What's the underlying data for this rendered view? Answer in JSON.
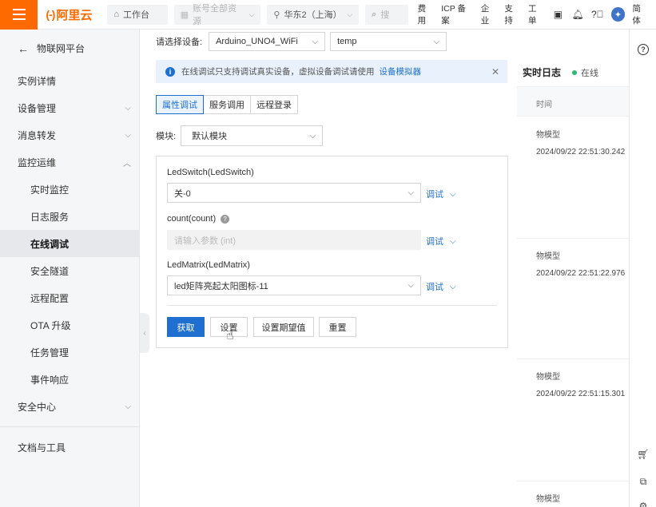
{
  "topbar": {
    "brand": "阿里云",
    "brand_mark": "(-)",
    "workbench": "工作台",
    "account_scope": "账号全部资源",
    "region": "华东2（上海）",
    "search_placeholder": "搜",
    "links": [
      "费用",
      "ICP 备案",
      "企业",
      "支持",
      "工单"
    ],
    "lang": "简体"
  },
  "sidebar": {
    "back_label": "物联网平台",
    "items": [
      {
        "label": "实例详情",
        "expandable": false
      },
      {
        "label": "设备管理",
        "expandable": true,
        "expanded": false
      },
      {
        "label": "消息转发",
        "expandable": true,
        "expanded": false
      },
      {
        "label": "监控运维",
        "expandable": true,
        "expanded": true
      },
      {
        "label": "实时监控",
        "sub": true
      },
      {
        "label": "日志服务",
        "sub": true
      },
      {
        "label": "在线调试",
        "sub": true,
        "active": true
      },
      {
        "label": "安全隧道",
        "sub": true
      },
      {
        "label": "远程配置",
        "sub": true
      },
      {
        "label": "OTA 升级",
        "sub": true
      },
      {
        "label": "任务管理",
        "sub": true
      },
      {
        "label": "事件响应",
        "sub": true
      },
      {
        "label": "安全中心",
        "expandable": true,
        "expanded": false
      }
    ],
    "footer_item": "文档与工具"
  },
  "device": {
    "label": "请选择设备:",
    "product": "Arduino_UNO4_WiFi",
    "device_name": "temp"
  },
  "info": {
    "text": "在线调试只支持调试真实设备，虚拟设备调试请使用",
    "link": "设备模拟器"
  },
  "tabs": [
    "属性调试",
    "服务调用",
    "远程登录"
  ],
  "module": {
    "label": "模块:",
    "value": "默认模块"
  },
  "properties": [
    {
      "label": "LedSwitch(LedSwitch)",
      "value": "关-0",
      "type": "select",
      "debug": "调试"
    },
    {
      "label": "count(count)",
      "placeholder": "请输入参数 (int)",
      "type": "input",
      "help": true,
      "debug": "调试"
    },
    {
      "label": "LedMatrix(LedMatrix)",
      "value": "led矩阵亮起太阳图标-11",
      "type": "select",
      "debug": "调试"
    }
  ],
  "actions": {
    "get": "获取",
    "set": "设置",
    "set_expected": "设置期望值",
    "reset": "重置"
  },
  "log": {
    "title": "实时日志",
    "status": "在线",
    "column": "时间",
    "entries": [
      {
        "type": "物模型",
        "time": "2024/09/22 22:51:30.242"
      },
      {
        "type": "物模型",
        "time": "2024/09/22 22:51:22.976"
      },
      {
        "type": "物模型",
        "time": "2024/09/22 22:51:15.301"
      },
      {
        "type": "物模型",
        "time": ""
      }
    ]
  },
  "colors": {
    "brand": "#ff6a00",
    "primary": "#1e6fd0",
    "online": "#2eb872",
    "info_bg": "#e8f1fc"
  }
}
